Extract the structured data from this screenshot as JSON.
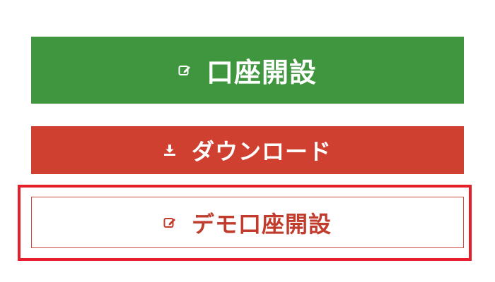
{
  "buttons": {
    "open_account": {
      "label": "口座開設",
      "icon": "edit-icon",
      "color": "#3f963f",
      "text_color": "#ffffff"
    },
    "download": {
      "label": "ダウンロード",
      "icon": "download-icon",
      "color": "#cf4030",
      "text_color": "#ffffff"
    },
    "demo_account": {
      "label": "デモ口座開設",
      "icon": "edit-icon",
      "color": "#ffffff",
      "text_color": "#c23c2d",
      "highlight_color": "#e41e2a"
    }
  }
}
